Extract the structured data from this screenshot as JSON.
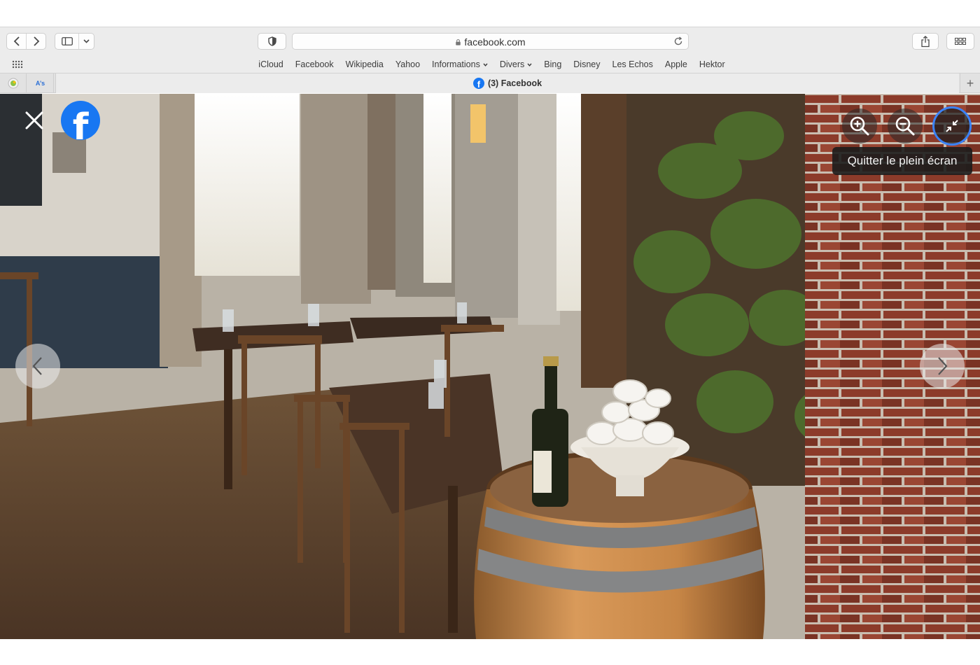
{
  "browser": {
    "url": "facebook.com",
    "bookmarks": [
      {
        "label": "iCloud",
        "dropdown": false
      },
      {
        "label": "Facebook",
        "dropdown": false
      },
      {
        "label": "Wikipedia",
        "dropdown": false
      },
      {
        "label": "Yahoo",
        "dropdown": false
      },
      {
        "label": "Informations",
        "dropdown": true
      },
      {
        "label": "Divers",
        "dropdown": true
      },
      {
        "label": "Bing",
        "dropdown": false
      },
      {
        "label": "Disney",
        "dropdown": false
      },
      {
        "label": "Les Echos",
        "dropdown": false
      },
      {
        "label": "Apple",
        "dropdown": false
      },
      {
        "label": "Hektor",
        "dropdown": false
      }
    ],
    "active_tab_title": "(3) Facebook",
    "pinned_tab_2_label": "A’s"
  },
  "viewer": {
    "tooltip": "Quitter le plein écran",
    "brand_letter": "f",
    "accent_color": "#1877f2",
    "focus_ring_color": "#3b82f6"
  }
}
